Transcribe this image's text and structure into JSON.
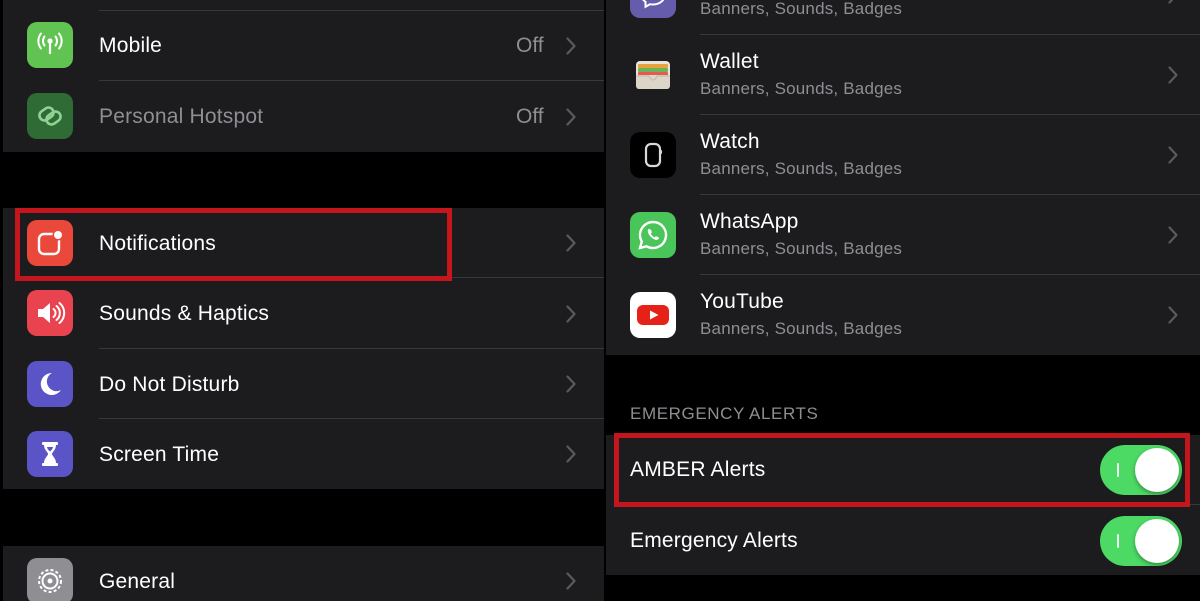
{
  "left": {
    "group1": [
      {
        "label": "Mobile",
        "value": "Off",
        "icon": "antenna-icon",
        "icon_color": "#61c452"
      },
      {
        "label": "Personal Hotspot",
        "value": "Off",
        "icon": "hotspot-link-icon",
        "icon_color": "#2f6b34",
        "dimmed": true
      }
    ],
    "group2": [
      {
        "label": "Notifications",
        "icon": "notifications-icon",
        "icon_color": "#e9483b"
      },
      {
        "label": "Sounds & Haptics",
        "icon": "speaker-icon",
        "icon_color": "#e9434f"
      },
      {
        "label": "Do Not Disturb",
        "icon": "moon-icon",
        "icon_color": "#5a54c6"
      },
      {
        "label": "Screen Time",
        "icon": "hourglass-icon",
        "icon_color": "#5a54c6"
      }
    ],
    "group3": [
      {
        "label": "General",
        "icon": "gear-icon",
        "icon_color": "#8e8e93"
      }
    ]
  },
  "right": {
    "apps": [
      {
        "label": "",
        "subtitle": "Banners, Sounds, Badges",
        "icon": "messenger-app-icon",
        "icon_color": "#665cac"
      },
      {
        "label": "Wallet",
        "subtitle": "Banners, Sounds, Badges",
        "icon": "wallet-icon",
        "icon_color": "#1c1c1e"
      },
      {
        "label": "Watch",
        "subtitle": "Banners, Sounds, Badges",
        "icon": "watch-icon",
        "icon_color": "#000000"
      },
      {
        "label": "WhatsApp",
        "subtitle": "Banners, Sounds, Badges",
        "icon": "whatsapp-icon",
        "icon_color": "#4ac55a"
      },
      {
        "label": "YouTube",
        "subtitle": "Banners, Sounds, Badges",
        "icon": "youtube-icon",
        "icon_color": "#ffffff"
      }
    ],
    "section_header": "EMERGENCY ALERTS",
    "toggles": [
      {
        "label": "AMBER Alerts",
        "on": true
      },
      {
        "label": "Emergency Alerts",
        "on": true
      }
    ]
  },
  "colors": {
    "background": "#000000",
    "cell": "#1c1c1e",
    "separator": "#38383a",
    "secondary_text": "#8e8e93",
    "toggle_on": "#4cd964",
    "highlight": "#c4161c"
  }
}
